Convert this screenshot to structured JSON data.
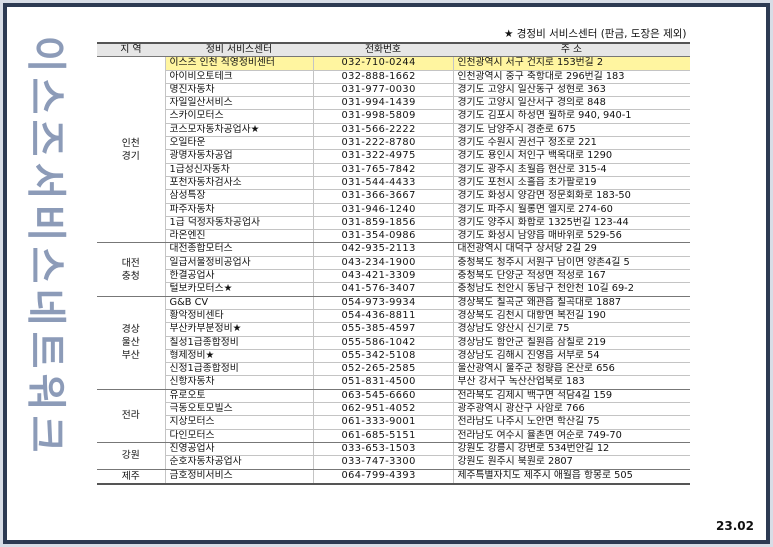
{
  "side_title": [
    "이",
    "스",
    "즈",
    "서",
    "비",
    "스",
    "네",
    "트",
    "워",
    "크"
  ],
  "note": "★ 경정비 서비스센터 (판금, 도장은 제외)",
  "headers": {
    "region": "지 역",
    "center": "정비 서비스센터",
    "phone": "전화번호",
    "address": "주 소"
  },
  "groups": [
    {
      "region": [
        "인천",
        "경기"
      ],
      "rows": [
        {
          "center": "이스즈 인천 직영정비센터",
          "phone": "032-710-0244",
          "address": "인천광역시 서구 건지로 153번길 2",
          "highlight": true
        },
        {
          "center": "아이비오토테크",
          "phone": "032-888-1662",
          "address": "인천광역시 중구 축항대로 296번길 183"
        },
        {
          "center": "명진자동차",
          "phone": "031-977-0030",
          "address": "경기도 고양시 일산동구 성현로 363"
        },
        {
          "center": "자일일산서비스",
          "phone": "031-994-1439",
          "address": "경기도 고양시 일산서구 경의로 848"
        },
        {
          "center": "스카이모터스",
          "phone": "031-998-5809",
          "address": "경기도 김포시 하성면 월하로 940, 940-1"
        },
        {
          "center": "코스모자동차공업사★",
          "phone": "031-566-2222",
          "address": "경기도 남양주시 경춘로 675"
        },
        {
          "center": "오일타운",
          "phone": "031-222-8780",
          "address": "경기도 수원시 권선구 정조로 221"
        },
        {
          "center": "광명자동차공업",
          "phone": "031-322-4975",
          "address": "경기도 용인시 처인구 백옥대로 1290"
        },
        {
          "center": "1급성신자동차",
          "phone": "031-765-7842",
          "address": "경기도 광주시 초월읍 현산로 315-4"
        },
        {
          "center": "포천자동차검사소",
          "phone": "031-544-4433",
          "address": "경기도 포천시 소흘읍 초가팔로19"
        },
        {
          "center": "삼성특장",
          "phone": "031-366-3667",
          "address": "경기도 화성시 양감면 정문회화로 183-50"
        },
        {
          "center": "파주자동차",
          "phone": "031-946-1240",
          "address": "경기도 파주시 월롱면 엘지로 274-60"
        },
        {
          "center": "1급 덕정자동차공업사",
          "phone": "031-859-1856",
          "address": "경기도 양주시 화합로 1325번길 123-44"
        },
        {
          "center": "라온엔진",
          "phone": "031-354-0986",
          "address": "경기도 화성시 남양읍 매바위로 529-56"
        }
      ]
    },
    {
      "region": [
        "대전",
        "충청"
      ],
      "rows": [
        {
          "center": "대전종합모터스",
          "phone": "042-935-2113",
          "address": "대전광역시 대덕구 상서당 2길 29"
        },
        {
          "center": "일급서울정비공업사",
          "phone": "043-234-1900",
          "address": "충청북도 청주시 서원구 남이면 양촌4길 5"
        },
        {
          "center": "한결공업사",
          "phone": "043-421-3309",
          "address": "충청북도 단양군 적성면 적성로 167"
        },
        {
          "center": "털보카모터스★",
          "phone": "041-576-3407",
          "address": "충청남도 천안시 동남구 천안천 10길 69-2"
        }
      ]
    },
    {
      "region": [
        "경상",
        "울산",
        "부산"
      ],
      "rows": [
        {
          "center": "G&B CV",
          "phone": "054-973-9934",
          "address": "경상북도 칠곡군 왜관읍 칠곡대로 1887"
        },
        {
          "center": "황악정비센타",
          "phone": "054-436-8811",
          "address": "경상북도 김천시 대항면 복전길 190"
        },
        {
          "center": "부산카부분정비★",
          "phone": "055-385-4597",
          "address": "경상남도 양산시 신기로 75"
        },
        {
          "center": "칠성1급종합정비",
          "phone": "055-586-1042",
          "address": "경상남도 함안군 칠원읍 삼칠로 219"
        },
        {
          "center": "형제정비★",
          "phone": "055-342-5108",
          "address": "경상남도 김해시 진영읍 서부로 54"
        },
        {
          "center": "신정1급종합정비",
          "phone": "052-265-2585",
          "address": "울산광역시 울주군 청량읍 온산로 656"
        },
        {
          "center": "신항자동차",
          "phone": "051-831-4500",
          "address": "부산 강서구 녹산산업북로 183"
        }
      ]
    },
    {
      "region": [
        "전라"
      ],
      "rows": [
        {
          "center": "유로오토",
          "phone": "063-545-6660",
          "address": "전라북도 김제시 백구면 석담4길 159"
        },
        {
          "center": "극동오토모빌스",
          "phone": "062-951-4052",
          "address": "광주광역시 광산구 사암로 766"
        },
        {
          "center": "지상모터스",
          "phone": "061-333-9001",
          "address": "전라남도 나주시 노안면 학산길 75"
        },
        {
          "center": "다인모터스",
          "phone": "061-685-5151",
          "address": "전라남도 여수시 율촌면 여순로 749-70"
        }
      ]
    },
    {
      "region": [
        "강원"
      ],
      "rows": [
        {
          "center": "진영공업사",
          "phone": "033-653-1503",
          "address": "강원도 강릉시 강변로 534번안길 12"
        },
        {
          "center": "순호자동차공업사",
          "phone": "033-747-3300",
          "address": "강원도 원주시 북원로 2807"
        }
      ]
    },
    {
      "region": [
        "제주"
      ],
      "rows": [
        {
          "center": "금호정비서비스",
          "phone": "064-799-4393",
          "address": "제주특별자치도 제주시 애월읍 항몽로 505"
        }
      ]
    }
  ],
  "date": "23.02"
}
